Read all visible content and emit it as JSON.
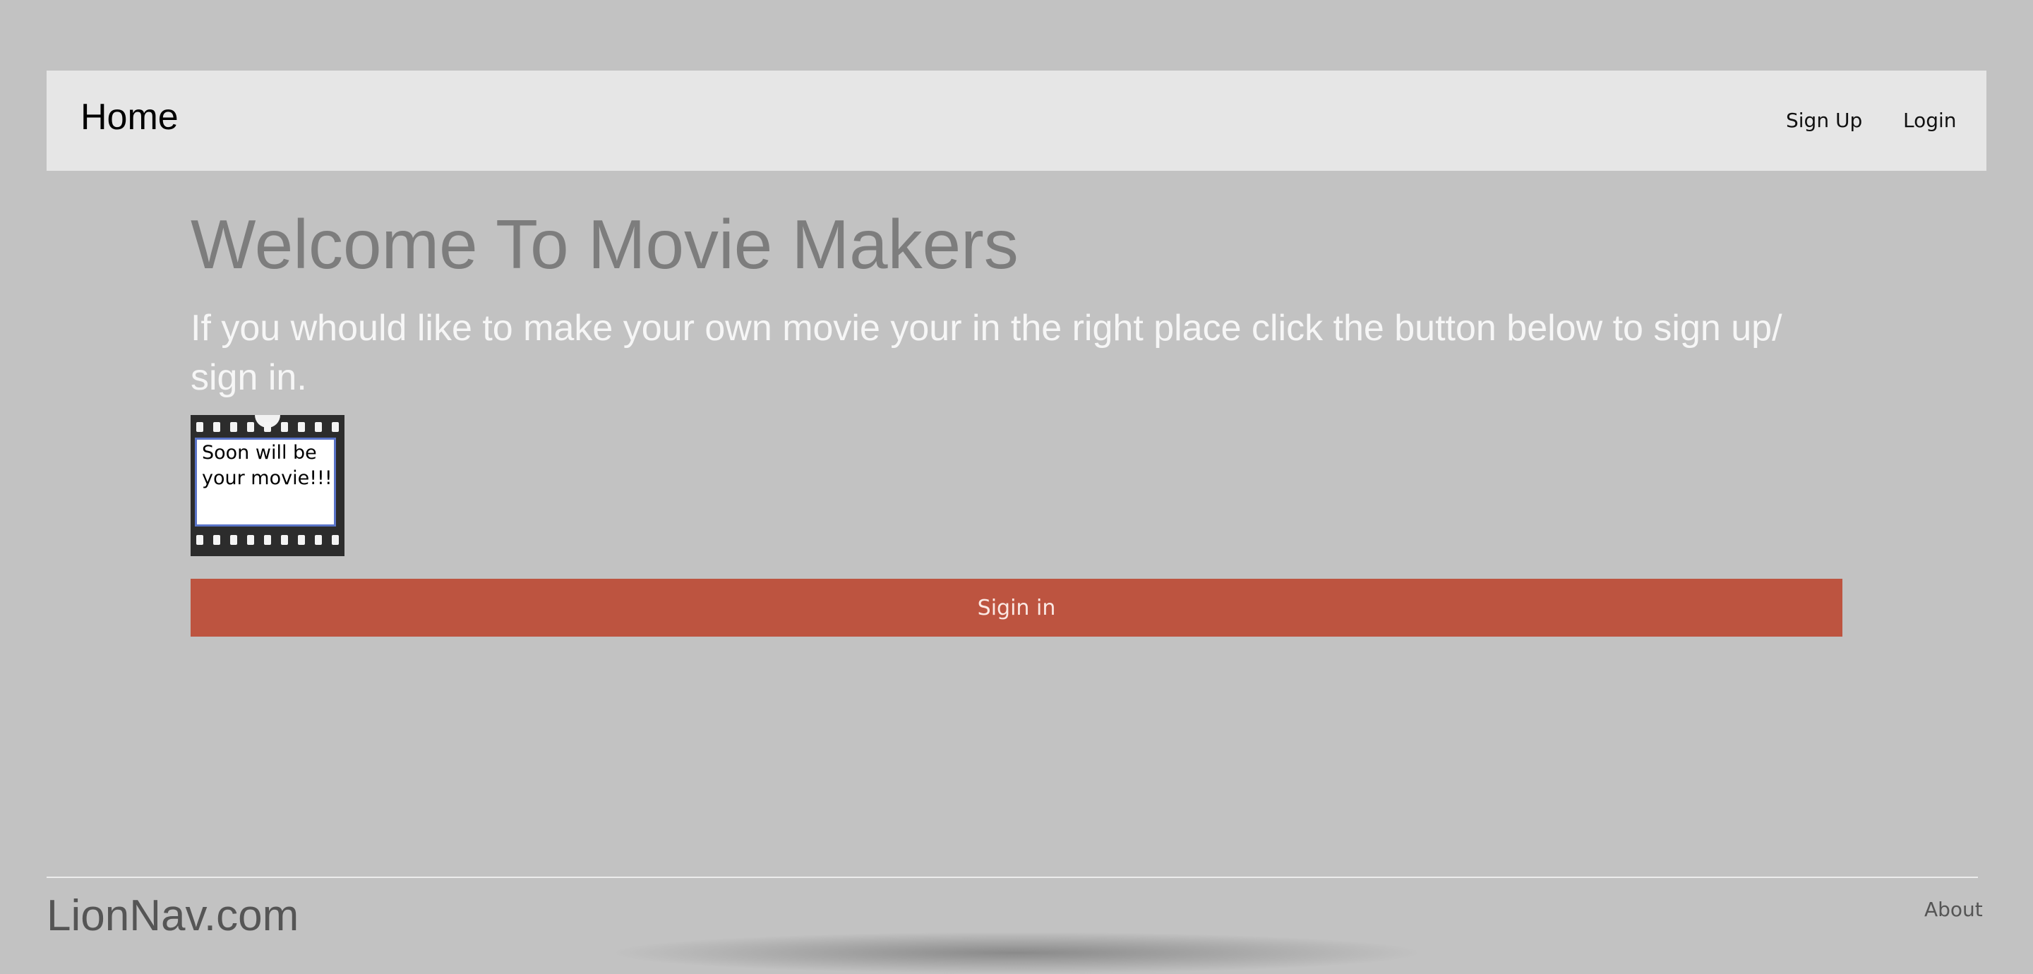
{
  "navbar": {
    "brand": "Home",
    "links": [
      {
        "label": "Sign Up"
      },
      {
        "label": "Login"
      }
    ]
  },
  "hero": {
    "title": "Welcome To Movie Makers",
    "text": "If you whould like to make your own movie your in the right place click the button below to sign up/ sign in."
  },
  "film_image": {
    "caption": "Soon will be your movie!!!",
    "icon": "film-strip-icon"
  },
  "signin_button": {
    "label": "Sigin in",
    "color": "#bd5440"
  },
  "footer": {
    "brand": "LionNav.com",
    "about": "About"
  },
  "colors": {
    "background": "#c2c2c2",
    "navbar": "#e6e6e6",
    "title": "#7d7d7d"
  }
}
